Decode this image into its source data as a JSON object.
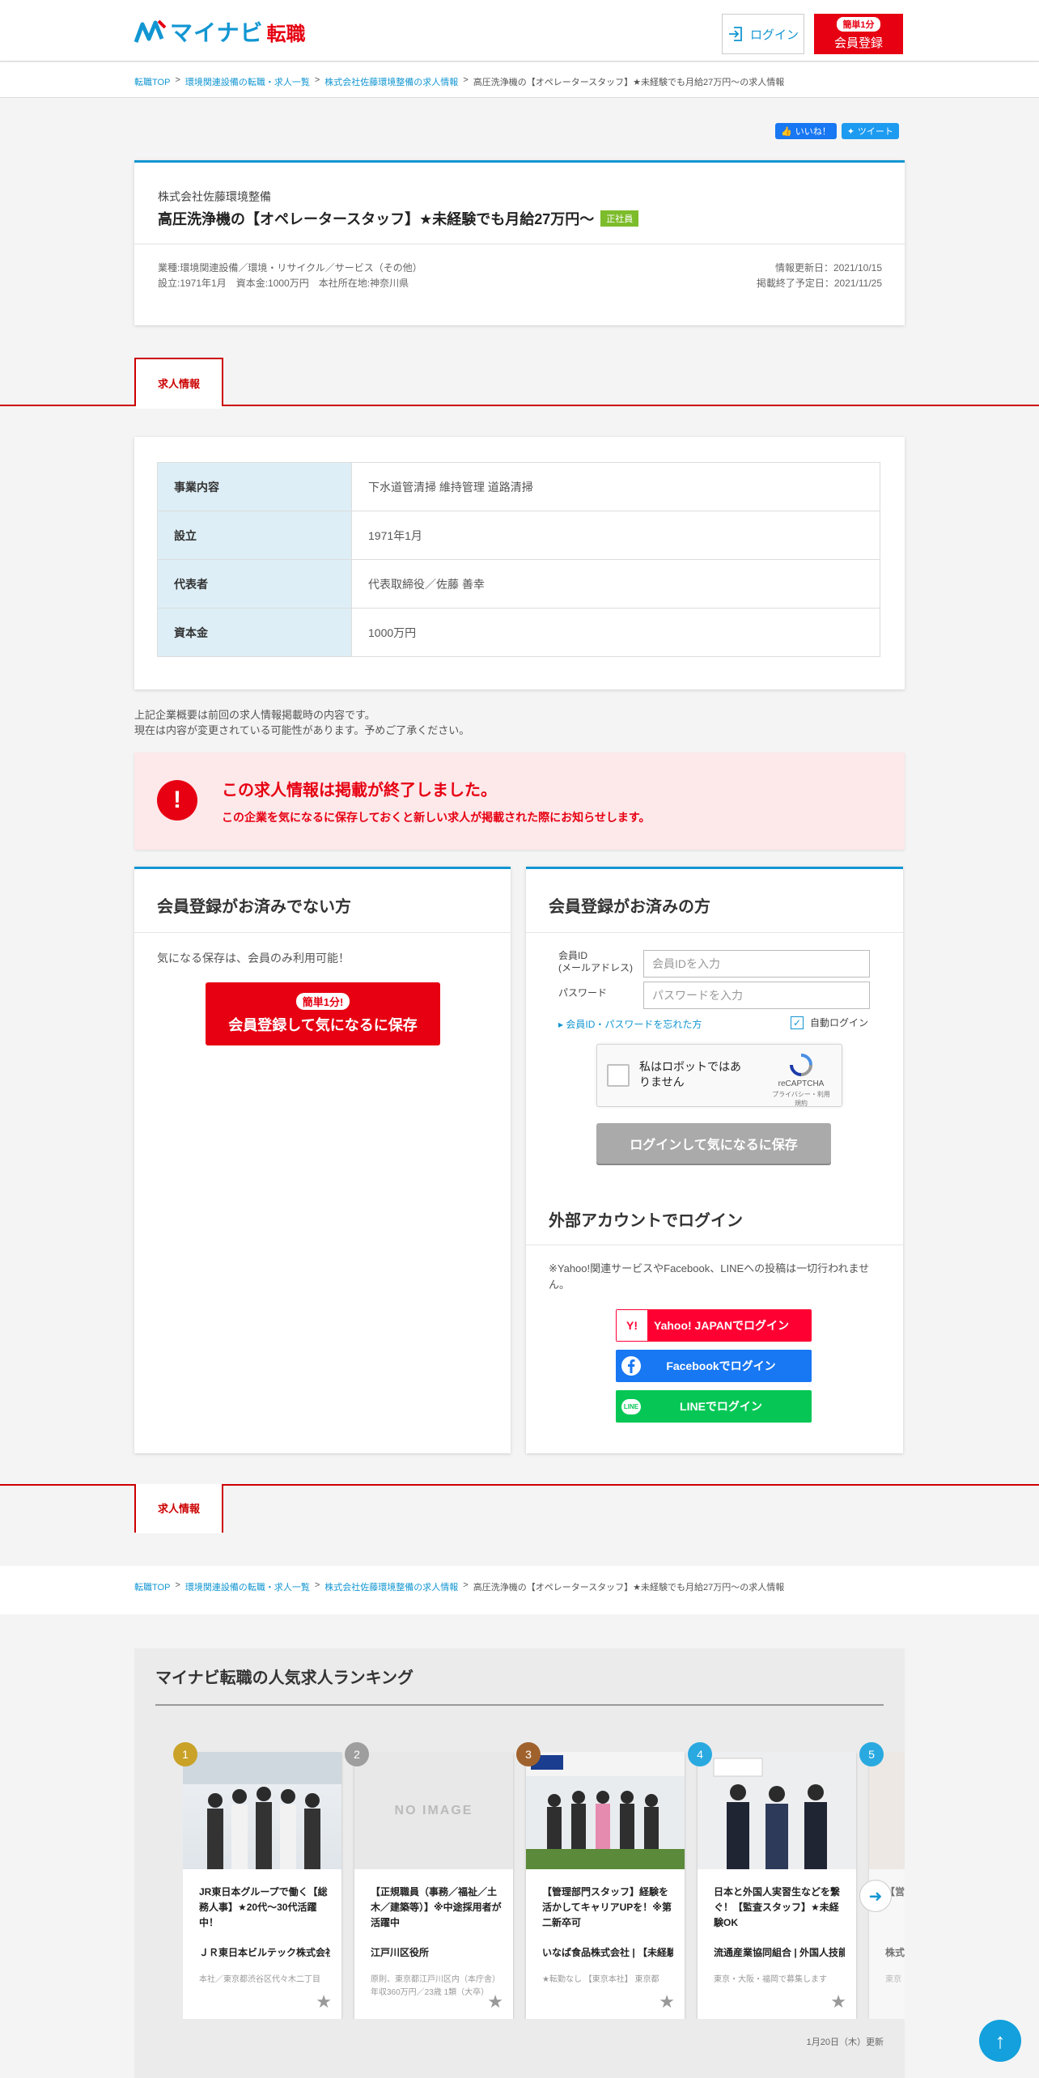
{
  "header": {
    "logo_main": "マイナビ",
    "logo_sub": "転職",
    "login_label": "ログイン",
    "register_pill": "簡単1分",
    "register_label": "会員登録"
  },
  "breadcrumb": {
    "items": [
      "転職TOP",
      "環境関連設備の転職・求人一覧",
      "株式会社佐藤環境整備の求人情報"
    ],
    "current": "高圧洗浄機の【オペレータースタッフ】★未経験でも月給27万円～の求人情報",
    "separator": ">"
  },
  "social": {
    "like_label": "いいね！",
    "tweet_label": "ツイート"
  },
  "job": {
    "company": "株式会社佐藤環境整備",
    "title": "高圧洗浄機の【オペレータースタッフ】★未経験でも月給27万円～",
    "employment_type": "正社員",
    "industry": "業種:環境関連設備／環境・リサイクル／サービス（その他）",
    "established_info": "設立:1971年1月　資本金:1000万円　本社所在地:神奈川県",
    "updated": "情報更新日：2021/10/15",
    "end_date": "掲載終了予定日：2021/11/25"
  },
  "tab_label": "求人情報",
  "company_table": [
    {
      "label": "事業内容",
      "value": "下水道管清掃 維持管理 道路清掃"
    },
    {
      "label": "設立",
      "value": "1971年1月"
    },
    {
      "label": "代表者",
      "value": "代表取締役／佐藤 善幸"
    },
    {
      "label": "資本金",
      "value": "1000万円"
    }
  ],
  "note": {
    "line1": "上記企業概要は前回の求人情報掲載時の内容です。",
    "line2": "現在は内容が変更されている可能性があります。予めご了承ください。"
  },
  "closed": {
    "icon": "!",
    "title": "この求人情報は掲載が終了しました。",
    "subtitle": "この企業を気になるに保存しておくと新しい求人が掲載された際にお知らせします。"
  },
  "panel_unregistered": {
    "heading": "会員登録がお済みでない方",
    "text": "気になる保存は、会員のみ利用可能！",
    "button_pill": "簡単1分!",
    "button_label": "会員登録して気になるに保存"
  },
  "panel_registered": {
    "heading": "会員登録がお済みの方",
    "id_label_1": "会員ID",
    "id_label_2": "(メールアドレス)",
    "id_placeholder": "会員IDを入力",
    "password_label": "パスワード",
    "password_placeholder": "パスワードを入力",
    "forgot_label": "▸ 会員ID・パスワードを忘れた方",
    "autologin_label": "自動ログイン",
    "autologin_checked": true,
    "recaptcha_text": "私はロボットではありません",
    "recaptcha_brand": "reCAPTCHA",
    "recaptcha_links": "プライバシー・利用規約",
    "login_button": "ログインして気になるに保存",
    "external_heading": "外部アカウントでログイン",
    "external_note": "※Yahoo!関連サービスやFacebook、LINEへの投稿は一切行われません。",
    "yahoo_label": "Yahoo! JAPANでログイン",
    "facebook_label": "Facebookでログイン",
    "line_label": "LINEでログイン",
    "yahoo_icon": "Y!",
    "line_icon": "LINE"
  },
  "ranking": {
    "title": "マイナビ転職の人気求人ランキング",
    "updated": "1月20日（木）更新",
    "noimage_label": "NO IMAGE",
    "items": [
      {
        "rank": "1",
        "title": "JR東日本グループで働く【総務人事】★20代～30代活躍中！",
        "company": "ＪＲ東日本ビルテック株式会社",
        "location": "本社／東京都渋谷区代々木二丁目",
        "color": "#c9a227"
      },
      {
        "rank": "2",
        "title": "【正規職員（事務／福祉／土木／建築等）】※中途採用者が活躍中",
        "company": "江戸川区役所",
        "location": "原則、東京都江戸川区内（本庁舎）年収360万円／23歳 1類（大卒）",
        "color": "#9e9e9e"
      },
      {
        "rank": "3",
        "title": "【管理部門スタッフ】経験を活かしてキャリアUPを！※第二新卒可",
        "company": "いなば食品株式会社 | 【未経験者歓迎】",
        "location": "★転勤なし 【東京本社】 東京都",
        "color": "#a0622d"
      },
      {
        "rank": "4",
        "title": "日本と外国人実習生などを繋ぐ！【監査スタッフ】★未経験OK",
        "company": "流通産業協同組合 | 外国人技能実習生",
        "location": "東京・大阪・福岡で募集します",
        "color": "#29a9e0"
      },
      {
        "rank": "5",
        "title": "【営業】未経験からスタート",
        "company": "株式会社",
        "location": "東京",
        "color": "#29a9e0"
      }
    ]
  },
  "icons": {
    "login": "login-icon",
    "star": "star-icon",
    "arrow_next": "arrow-right-icon",
    "pagetop": "arrow-up-icon"
  },
  "colors": {
    "brand_blue": "#1296d2",
    "brand_red": "#e60012",
    "yahoo": "#ff0033",
    "facebook": "#1877f2",
    "line": "#06c755"
  }
}
